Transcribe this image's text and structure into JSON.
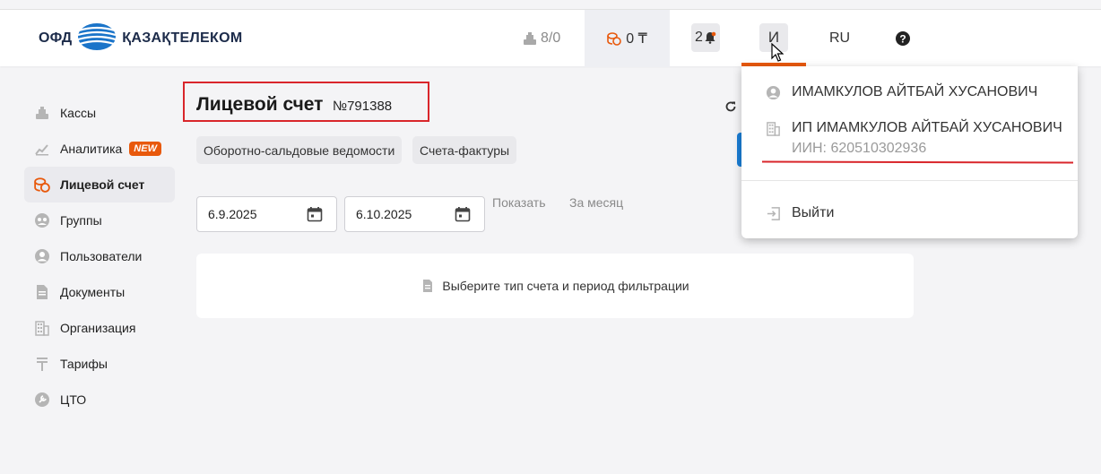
{
  "header": {
    "logo": {
      "ofd": "ОФД",
      "brand": "ҚАЗАҚТЕЛЕКОМ"
    },
    "kassa_count": "8/0",
    "balance": "0 ₸",
    "notifications": "2",
    "user_initial": "И",
    "language": "RU"
  },
  "sidebar": {
    "items": [
      {
        "label": "Кассы",
        "icon": "cash-register-icon"
      },
      {
        "label": "Аналитика",
        "icon": "analytics-icon",
        "badge": "NEW"
      },
      {
        "label": "Лицевой счет",
        "icon": "coins-icon",
        "active": true
      },
      {
        "label": "Группы",
        "icon": "groups-icon"
      },
      {
        "label": "Пользователи",
        "icon": "user-icon"
      },
      {
        "label": "Документы",
        "icon": "document-icon"
      },
      {
        "label": "Организация",
        "icon": "building-icon"
      },
      {
        "label": "Тарифы",
        "icon": "tenge-icon"
      },
      {
        "label": "ЦТО",
        "icon": "service-icon"
      }
    ]
  },
  "main": {
    "title": "Лицевой счет",
    "account_number": "№791388",
    "tabs": [
      "Оборотно-сальдовые ведомости",
      "Счета-фактуры"
    ],
    "date_from": "6.9.2025",
    "date_to": "6.10.2025",
    "show_label": "Показать",
    "month_label": "За месяц",
    "empty_message": "Выберите тип счета и период фильтрации"
  },
  "dropdown": {
    "user_name": "ИМАМКУЛОВ АЙТБАЙ ХУСАНОВИЧ",
    "org_name": "ИП ИМАМКУЛОВ АЙТБАЙ ХУСАНОВИЧ",
    "iin": "ИИН: 620510302936",
    "logout": "Выйти"
  },
  "colors": {
    "accent": "#e8590c",
    "highlight_red": "#d9262b",
    "primary_blue": "#1a7ed6"
  }
}
